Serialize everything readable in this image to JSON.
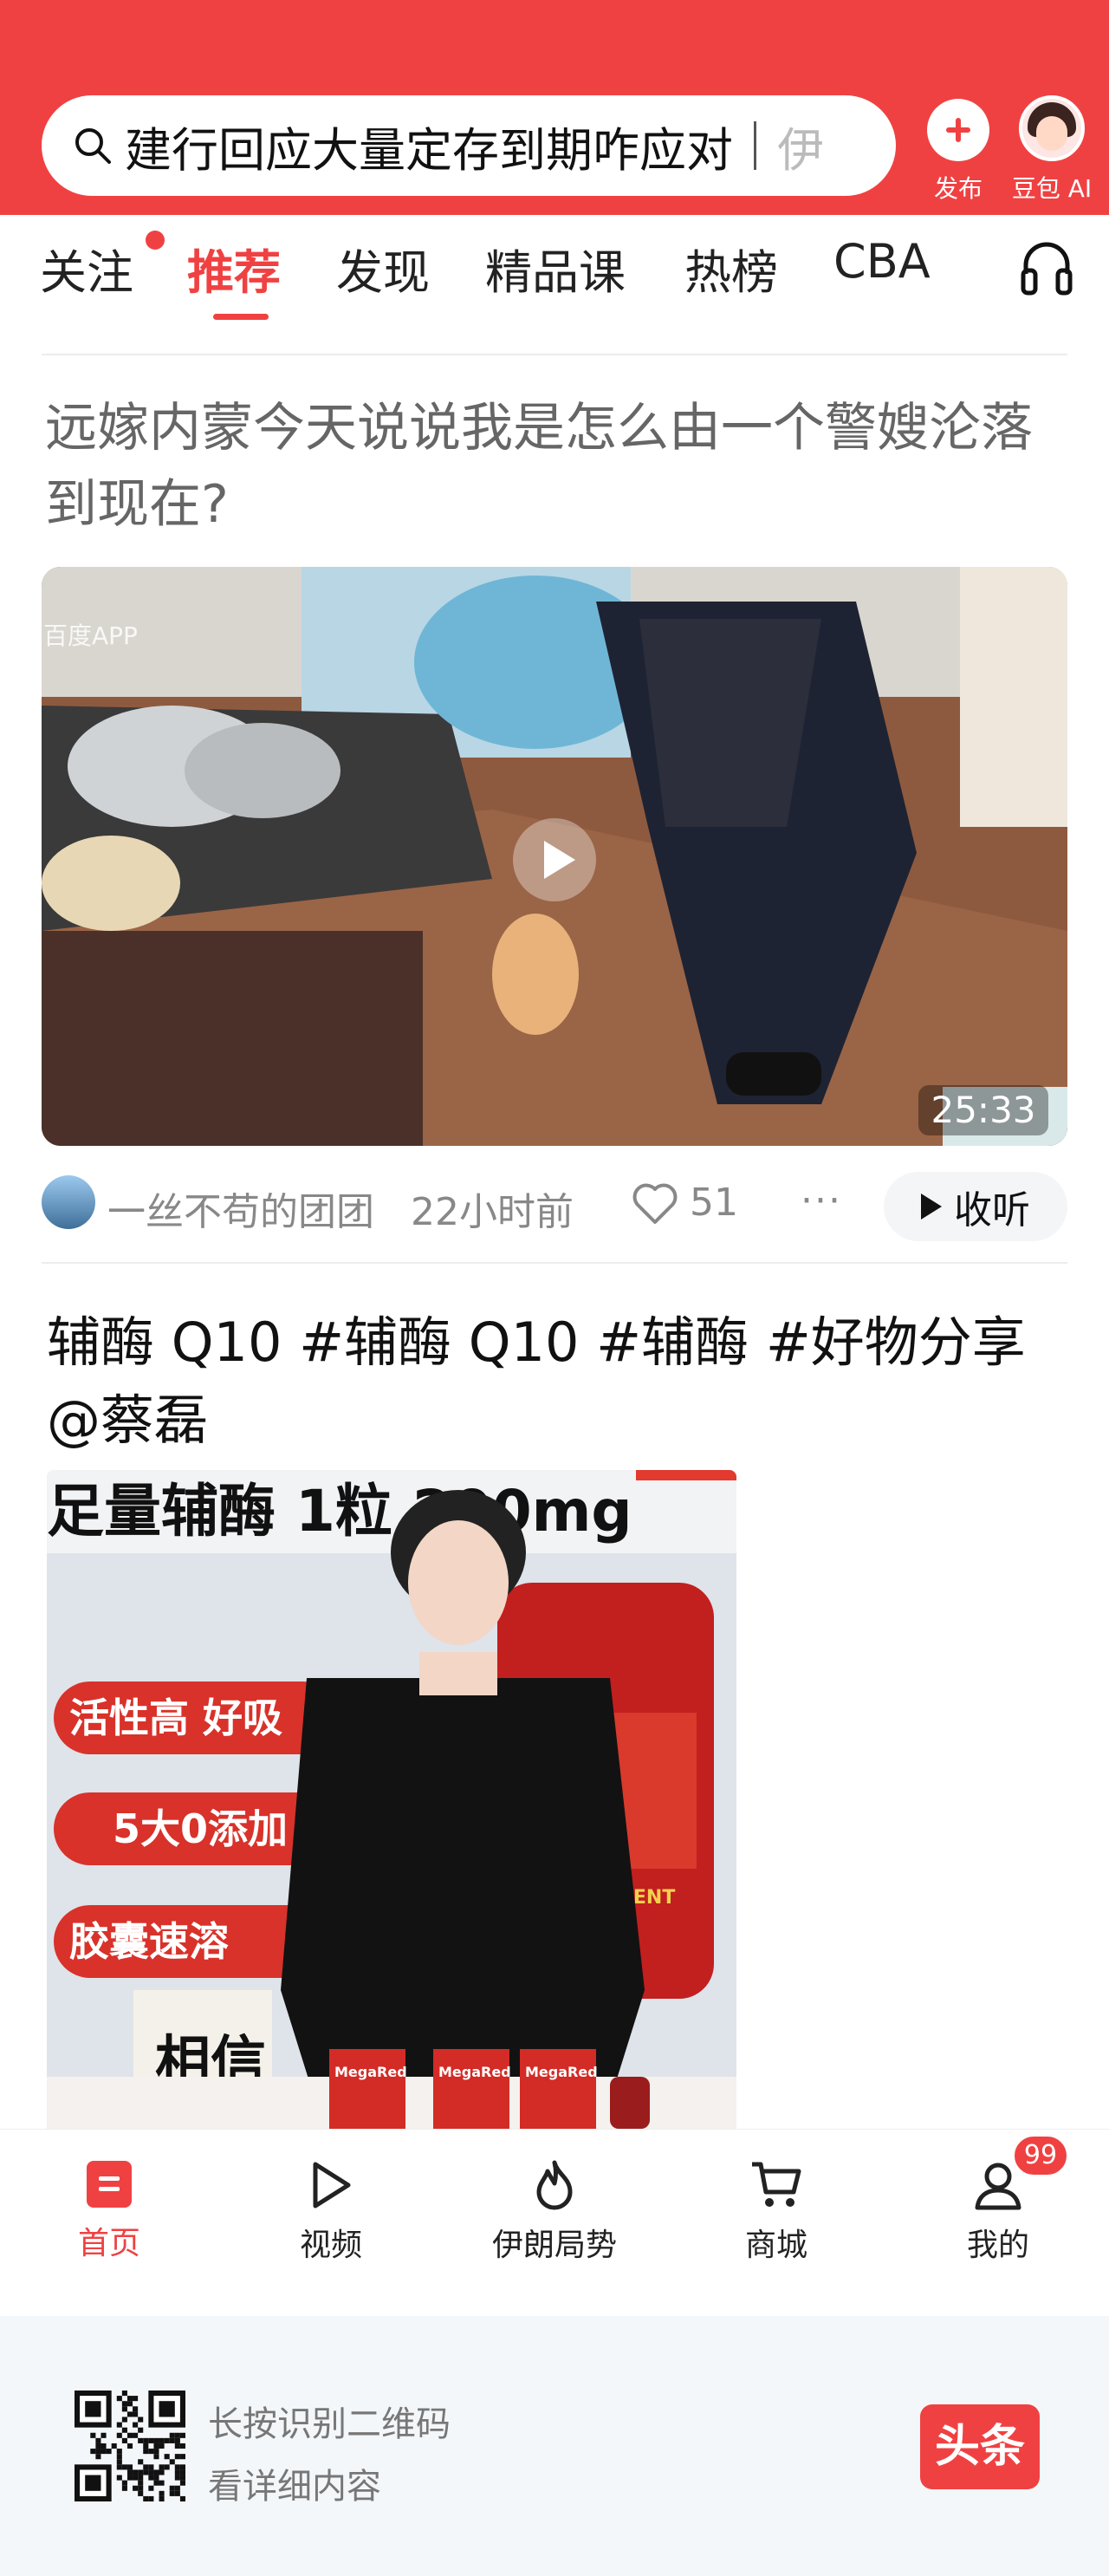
{
  "header": {
    "search_query": "建行回应大量定存到期咋应对",
    "search_next": "伊",
    "publish_label": "发布",
    "ai_label": "豆包 AI"
  },
  "tabs": [
    "关注",
    "推荐",
    "发现",
    "精品课",
    "热榜",
    "CBA"
  ],
  "active_tab": "推荐",
  "article1": {
    "title": "远嫁内蒙今天说说我是怎么由一个警嫂沦落到现在?",
    "watermark": "百度APP",
    "duration": "25:33",
    "author": "一丝不苟的团团",
    "time": "22小时前",
    "likes": "51",
    "more": "···",
    "listen_label": "收听"
  },
  "article2": {
    "title": "辅酶 Q10 #辅酶 Q10 #辅酶 #好物分享@蔡磊",
    "banner_text": "足量辅酶 1粒 200mg",
    "pill1": "活性高 好吸",
    "pill2": "5大0添加",
    "pill3": "胶囊速溶",
    "book_text": "相信",
    "product_label": "MegaRed",
    "bottle_text": "SUPPLEMENT"
  },
  "bottom_nav": {
    "items": [
      "首页",
      "视频",
      "伊朗局势",
      "商城",
      "我的"
    ],
    "active": "首页",
    "badge": "99"
  },
  "footer": {
    "line1": "长按识别二维码",
    "line2": "看详细内容",
    "brand": "头条"
  },
  "colors": {
    "accent": "#f04142",
    "footer_bg": "#f4f7fa"
  }
}
